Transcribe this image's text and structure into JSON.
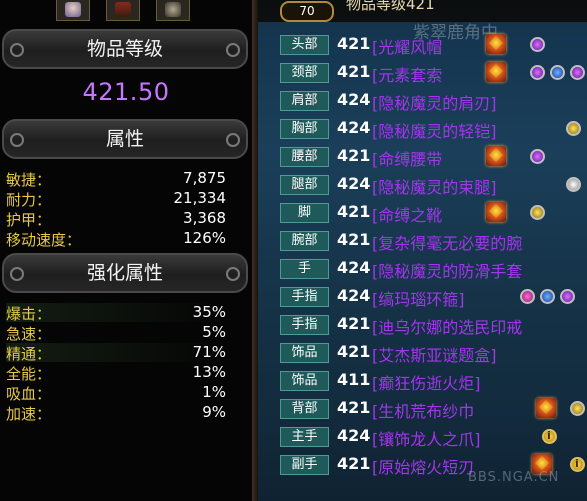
{
  "left": {
    "item_level_header": "物品等级",
    "item_level_value": "421.50",
    "attributes_header": "属性",
    "attributes": [
      {
        "label": "敏捷：",
        "value": "7,875"
      },
      {
        "label": "耐力：",
        "value": "21,334"
      },
      {
        "label": "护甲：",
        "value": "3,368"
      },
      {
        "label": "移动速度：",
        "value": "126%"
      }
    ],
    "enhancements_header": "强化属性",
    "enhancements": [
      {
        "label": "爆击：",
        "value": "35%"
      },
      {
        "label": "急速：",
        "value": "5%"
      },
      {
        "label": "精通：",
        "value": "71%"
      },
      {
        "label": "全能：",
        "value": "13%"
      },
      {
        "label": "吸血：",
        "value": "1%"
      },
      {
        "label": "加速：",
        "value": "9%"
      }
    ]
  },
  "right": {
    "level_badge": "70",
    "top_title": "物品等级421",
    "ghost_text": "紫翠鹿角中",
    "slots": [
      {
        "slot": "头部",
        "ilvl": "421",
        "name": "[光耀风帽"
      },
      {
        "slot": "颈部",
        "ilvl": "421",
        "name": "[元素套索"
      },
      {
        "slot": "肩部",
        "ilvl": "424",
        "name": "[隐秘魔灵的肩刃]"
      },
      {
        "slot": "胸部",
        "ilvl": "424",
        "name": "[隐秘魔灵的轻铠]"
      },
      {
        "slot": "腰部",
        "ilvl": "421",
        "name": "[命缚腰带"
      },
      {
        "slot": "腿部",
        "ilvl": "424",
        "name": "[隐秘魔灵的束腿]"
      },
      {
        "slot": "脚",
        "ilvl": "421",
        "name": "[命缚之靴"
      },
      {
        "slot": "腕部",
        "ilvl": "421",
        "name": "[复杂得毫无必要的腕"
      },
      {
        "slot": "手",
        "ilvl": "424",
        "name": "[隐秘魔灵的防滑手套"
      },
      {
        "slot": "手指",
        "ilvl": "424",
        "name": "[缟玛瑙环箍]"
      },
      {
        "slot": "手指",
        "ilvl": "421",
        "name": "[迪乌尔娜的选民印戒"
      },
      {
        "slot": "饰品",
        "ilvl": "421",
        "name": "[艾杰斯亚谜题盒]"
      },
      {
        "slot": "饰品",
        "ilvl": "411",
        "name": "[癫狂伤逝火炬]"
      },
      {
        "slot": "背部",
        "ilvl": "421",
        "name": "[生机荒布纱巾"
      },
      {
        "slot": "主手",
        "ilvl": "424",
        "name": "[镶饰龙人之爪]"
      },
      {
        "slot": "副手",
        "ilvl": "421",
        "name": "[原始熔火短刃"
      }
    ],
    "watermark": "BBS.NGA.CN"
  },
  "colors": {
    "epic": "#a335ee",
    "stat_label": "#e6c94a",
    "ilvl_value": "#c677ff"
  }
}
